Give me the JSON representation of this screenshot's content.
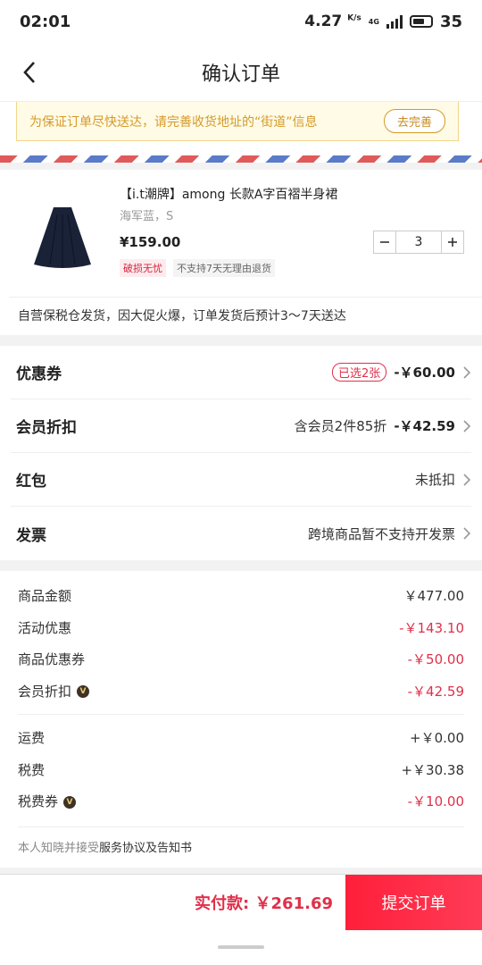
{
  "status_bar": {
    "time": "02:01",
    "speed": "4.27",
    "speed_unit": "K/s",
    "network": "4G",
    "battery": "35"
  },
  "header": {
    "title": "确认订单"
  },
  "notice": {
    "text": "为保证订单尽快送达，请完善收货地址的“街道”信息",
    "button": "去完善"
  },
  "product": {
    "name": "【i.t潮牌】among 长款A字百褶半身裙",
    "spec": "海军蓝，S",
    "price": "¥159.00",
    "quantity": "3",
    "tags": [
      "破损无忧",
      "不支持7天无理由退货"
    ],
    "shipping_note": "自营保税仓发货，因大促火爆，订单发货后预计3～7天送达"
  },
  "options": {
    "coupon": {
      "label": "优惠券",
      "badge": "已选2张",
      "amount": "-￥60.00"
    },
    "member": {
      "label": "会员折扣",
      "desc": "含会员2件85折",
      "amount": "-￥42.59"
    },
    "redpacket": {
      "label": "红包",
      "value": "未抵扣"
    },
    "invoice": {
      "label": "发票",
      "value": "跨境商品暂不支持开发票"
    }
  },
  "summary": {
    "rows1": [
      {
        "label": "商品金额",
        "value": "￥477.00"
      },
      {
        "label": "活动优惠",
        "value": "-￥143.10"
      },
      {
        "label": "商品优惠券",
        "value": "-￥50.00"
      },
      {
        "label": "会员折扣",
        "value": "-￥42.59"
      }
    ],
    "rows2": [
      {
        "label": "运费",
        "value": "+￥0.00"
      },
      {
        "label": "税费",
        "value": "+￥30.38"
      },
      {
        "label": "税费券",
        "value": "-￥10.00"
      }
    ],
    "agree_prefix": "本人知晓并接受",
    "agree_link": "服务协议及告知书"
  },
  "bottom": {
    "total_label": "实付款:",
    "total_value": "￥261.69",
    "submit": "提交订单"
  },
  "colors": {
    "accent": "#e0304a",
    "notice_text": "#d59a2a"
  }
}
